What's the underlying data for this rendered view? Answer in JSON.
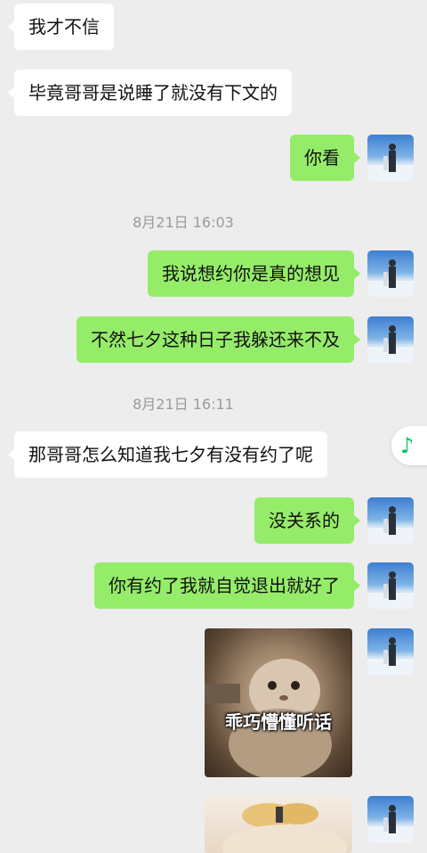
{
  "chat": {
    "messages": [
      {
        "sender": "other",
        "text": "我才不信"
      },
      {
        "sender": "other",
        "text": "毕竟哥哥是说睡了就没有下文的"
      },
      {
        "sender": "me",
        "text": "你看"
      },
      {
        "sender": "me",
        "text": "我说想约你是真的想见"
      },
      {
        "sender": "me",
        "text": "不然七夕这种日子我躲还来不及"
      },
      {
        "sender": "other",
        "text": "那哥哥怎么知道我七夕有没有约了呢"
      },
      {
        "sender": "me",
        "text": "没关系的"
      },
      {
        "sender": "me",
        "text": "你有约了我就自觉退出就好了"
      }
    ],
    "timestamps": [
      "8月21日 16:03",
      "8月21日 16:11"
    ],
    "stickers": [
      {
        "caption": "乖巧懵懂听话"
      }
    ]
  },
  "floating": {
    "music_icon": "music-note-icon",
    "glyph": "♪"
  },
  "colors": {
    "background": "#ededed",
    "incoming_bubble": "#ffffff",
    "outgoing_bubble": "#95ec69",
    "timestamp_text": "#9a9a9a",
    "accent": "#07c160"
  }
}
